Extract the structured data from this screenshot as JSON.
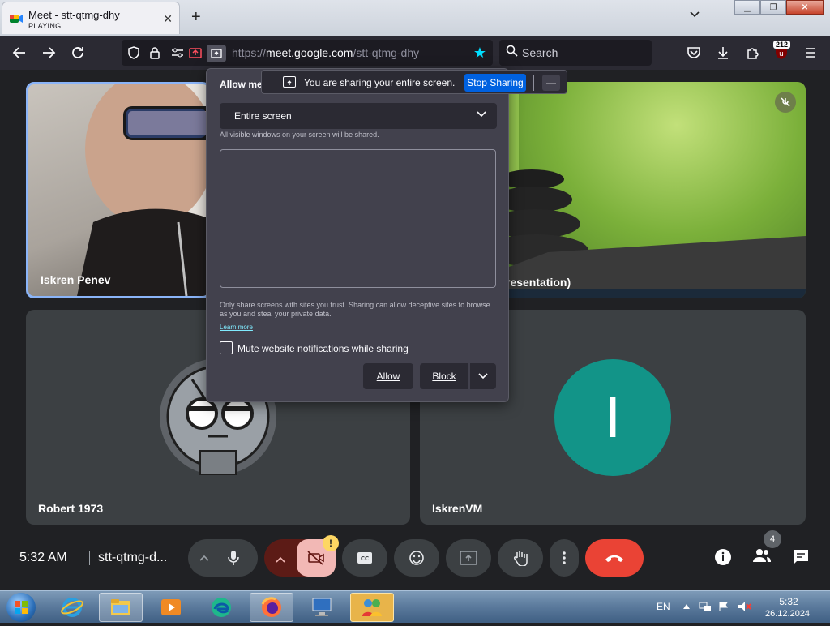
{
  "browser": {
    "tab": {
      "title": "Meet - stt-qtmg-dhy",
      "status": "PLAYING",
      "close": "✕"
    },
    "new_tab": "+",
    "tab_list": "⌄",
    "url": {
      "prefix": "https://",
      "host": "meet.google.com",
      "path": "/stt-qtmg-dhy"
    },
    "search": {
      "placeholder": "Search"
    },
    "extension_badge": "212",
    "window_controls": {
      "minimize": "▁",
      "restore": "❐",
      "close": "✕"
    }
  },
  "permission_dialog": {
    "title": "Allow mee",
    "select_value": "Entire screen",
    "hint": "All visible windows on your screen will be shared.",
    "warning": "Only share screens with sites you trust. Sharing can allow deceptive sites to browse as you and steal your private data.",
    "learn_more": "Learn more",
    "mute_label": "Mute website notifications while sharing",
    "mute_checked": false,
    "allow": "Allow",
    "block": "Block"
  },
  "sharing_notification": {
    "text": "You are sharing your entire screen.",
    "stop": "Stop Sharing",
    "minimize": "—"
  },
  "participants": [
    {
      "name": "Iskren Penev"
    },
    {
      "name": "resentation)"
    },
    {
      "name": "Robert 1973"
    },
    {
      "name": "IskrenVM",
      "initial": "I",
      "color": "#129488"
    }
  ],
  "meet_bar": {
    "time": "5:32 AM",
    "code": "stt-qtmg-d...",
    "people_count": "4",
    "camera_warning": "!",
    "end_call_color": "#ea4335"
  },
  "taskbar": {
    "language": "EN",
    "time": "5:32",
    "date": "26.12.2024"
  }
}
